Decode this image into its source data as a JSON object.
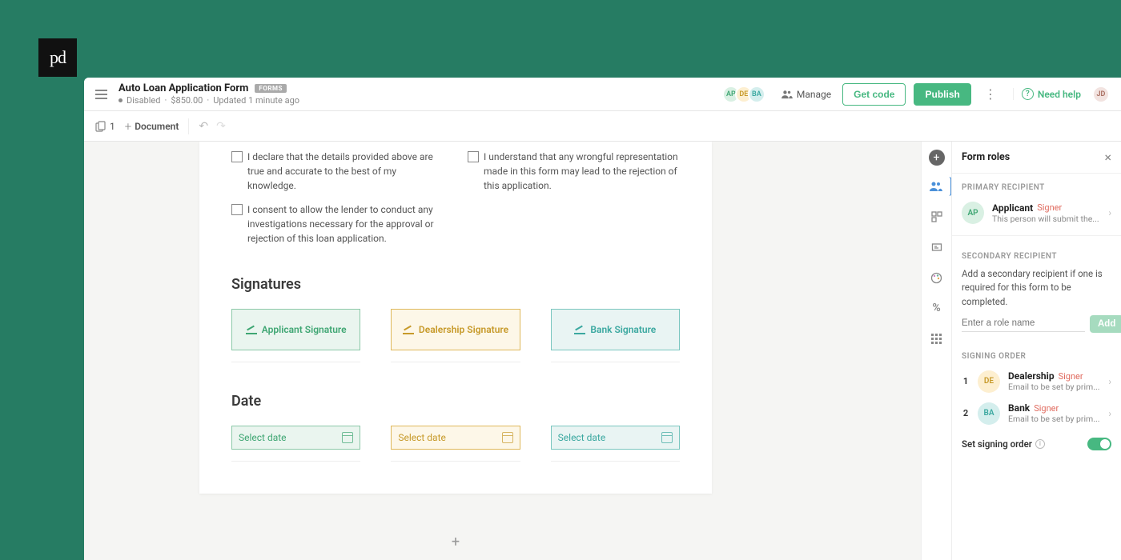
{
  "logo": "pd",
  "header": {
    "title": "Auto Loan Application Form",
    "badge": "FORMS",
    "status": "Disabled",
    "price": "$850.00",
    "updated": "Updated 1 minute ago",
    "avatars": [
      "AP",
      "DE",
      "BA"
    ],
    "manage_label": "Manage",
    "get_code_label": "Get code",
    "publish_label": "Publish",
    "help_label": "Need help",
    "user_avatar": "JD"
  },
  "toolbar": {
    "page_count": "1",
    "document_label": "Document"
  },
  "declarations": [
    "I declare that the details provided above are true and accurate to the best of my knowledge.",
    "I understand that any wrongful representation made in this form may lead to the rejection of this application.",
    "I consent to allow the lender to conduct any investigations necessary for the approval or rejection of this loan application."
  ],
  "sections": {
    "signatures": "Signatures",
    "date": "Date"
  },
  "signatures": [
    {
      "label": "Applicant Signature"
    },
    {
      "label": "Dealership Signature"
    },
    {
      "label": "Bank Signature"
    }
  ],
  "dates": [
    {
      "placeholder": "Select date"
    },
    {
      "placeholder": "Select date"
    },
    {
      "placeholder": "Select date"
    }
  ],
  "panel": {
    "title": "Form roles",
    "primary_label": "PRIMARY RECIPIENT",
    "primary": {
      "avatar": "AP",
      "name": "Applicant",
      "tag": "Signer",
      "desc": "This person will submit the..."
    },
    "secondary_label": "SECONDARY RECIPIENT",
    "secondary_text": "Add a secondary recipient if one is required for this form to be completed.",
    "role_placeholder": "Enter a role name",
    "add_label": "Add",
    "signing_order_label": "SIGNING ORDER",
    "order": [
      {
        "num": "1",
        "avatar": "DE",
        "name": "Dealership",
        "tag": "Signer",
        "desc": "Email to be set by prim..."
      },
      {
        "num": "2",
        "avatar": "BA",
        "name": "Bank",
        "tag": "Signer",
        "desc": "Email to be set by prim..."
      }
    ],
    "toggle_label": "Set signing order"
  }
}
